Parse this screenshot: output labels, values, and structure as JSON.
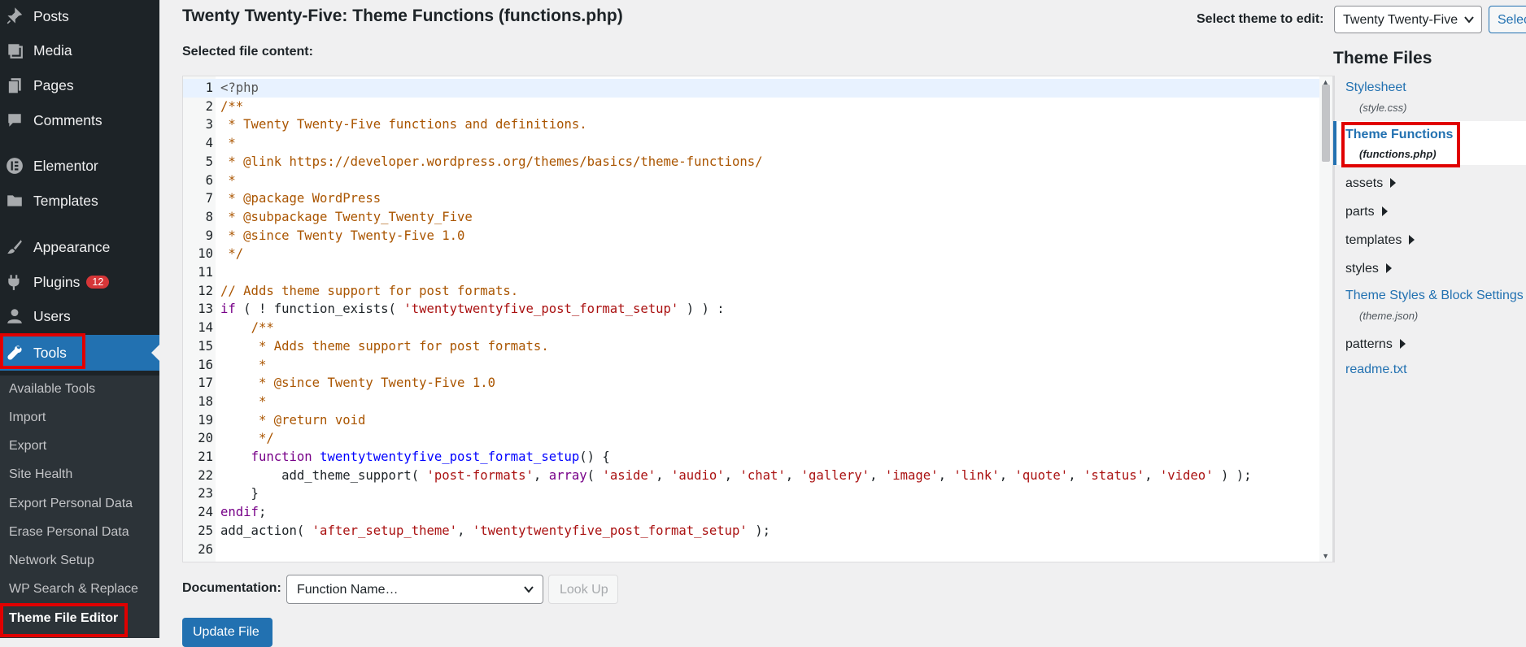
{
  "sidebar": {
    "menu": [
      {
        "label": "Posts",
        "icon": "pin-icon"
      },
      {
        "label": "Media",
        "icon": "media-icon"
      },
      {
        "label": "Pages",
        "icon": "pages-icon"
      },
      {
        "label": "Comments",
        "icon": "comment-icon"
      },
      {
        "label": "Elementor",
        "icon": "elementor-icon"
      },
      {
        "label": "Templates",
        "icon": "folder-icon"
      },
      {
        "label": "Appearance",
        "icon": "brush-icon"
      },
      {
        "label": "Plugins",
        "icon": "plug-icon",
        "badge": "12"
      },
      {
        "label": "Users",
        "icon": "user-icon"
      },
      {
        "label": "Tools",
        "icon": "wrench-icon"
      }
    ],
    "submenu": [
      "Available Tools",
      "Import",
      "Export",
      "Site Health",
      "Export Personal Data",
      "Erase Personal Data",
      "Network Setup",
      "WP Search & Replace",
      "Theme File Editor"
    ]
  },
  "header": {
    "title": "Twenty Twenty-Five: Theme Functions (functions.php)",
    "select_theme_label": "Select theme to edit:",
    "select_theme_value": "Twenty Twenty-Five",
    "select_button": "Select"
  },
  "editor": {
    "label": "Selected file content:",
    "lines": [
      [
        [
          "meta",
          "<?php"
        ]
      ],
      [
        [
          "comment",
          "/**"
        ]
      ],
      [
        [
          "comment",
          " * Twenty Twenty-Five functions and definitions."
        ]
      ],
      [
        [
          "comment",
          " *"
        ]
      ],
      [
        [
          "comment",
          " * @link https://developer.wordpress.org/themes/basics/theme-functions/"
        ]
      ],
      [
        [
          "comment",
          " *"
        ]
      ],
      [
        [
          "comment",
          " * @package WordPress"
        ]
      ],
      [
        [
          "comment",
          " * @subpackage Twenty_Twenty_Five"
        ]
      ],
      [
        [
          "comment",
          " * @since Twenty Twenty-Five 1.0"
        ]
      ],
      [
        [
          "comment",
          " */"
        ]
      ],
      [],
      [
        [
          "comment",
          "// Adds theme support for post formats."
        ]
      ],
      [
        [
          "keyword",
          "if"
        ],
        [
          "plain",
          " ( ! function_exists( "
        ],
        [
          "string",
          "'twentytwentyfive_post_format_setup'"
        ],
        [
          "plain",
          " ) ) :"
        ]
      ],
      [
        [
          "plain",
          "    "
        ],
        [
          "comment",
          "/**"
        ]
      ],
      [
        [
          "plain",
          "    "
        ],
        [
          "comment",
          " * Adds theme support for post formats."
        ]
      ],
      [
        [
          "plain",
          "    "
        ],
        [
          "comment",
          " *"
        ]
      ],
      [
        [
          "plain",
          "    "
        ],
        [
          "comment",
          " * @since Twenty Twenty-Five 1.0"
        ]
      ],
      [
        [
          "plain",
          "    "
        ],
        [
          "comment",
          " *"
        ]
      ],
      [
        [
          "plain",
          "    "
        ],
        [
          "comment",
          " * @return void"
        ]
      ],
      [
        [
          "plain",
          "    "
        ],
        [
          "comment",
          " */"
        ]
      ],
      [
        [
          "plain",
          "    "
        ],
        [
          "keyword",
          "function"
        ],
        [
          "plain",
          " "
        ],
        [
          "def",
          "twentytwentyfive_post_format_setup"
        ],
        [
          "plain",
          "() {"
        ]
      ],
      [
        [
          "plain",
          "        add_theme_support( "
        ],
        [
          "string",
          "'post-formats'"
        ],
        [
          "plain",
          ", "
        ],
        [
          "keyword",
          "array"
        ],
        [
          "plain",
          "( "
        ],
        [
          "string",
          "'aside'"
        ],
        [
          "plain",
          ", "
        ],
        [
          "string",
          "'audio'"
        ],
        [
          "plain",
          ", "
        ],
        [
          "string",
          "'chat'"
        ],
        [
          "plain",
          ", "
        ],
        [
          "string",
          "'gallery'"
        ],
        [
          "plain",
          ", "
        ],
        [
          "string",
          "'image'"
        ],
        [
          "plain",
          ", "
        ],
        [
          "string",
          "'link'"
        ],
        [
          "plain",
          ", "
        ],
        [
          "string",
          "'quote'"
        ],
        [
          "plain",
          ", "
        ],
        [
          "string",
          "'status'"
        ],
        [
          "plain",
          ", "
        ],
        [
          "string",
          "'video'"
        ],
        [
          "plain",
          " ) );"
        ]
      ],
      [
        [
          "plain",
          "    }"
        ]
      ],
      [
        [
          "keyword",
          "endif"
        ],
        [
          "plain",
          ";"
        ]
      ],
      [
        [
          "plain",
          "add_action( "
        ],
        [
          "string",
          "'after_setup_theme'"
        ],
        [
          "plain",
          ", "
        ],
        [
          "string",
          "'twentytwentyfive_post_format_setup'"
        ],
        [
          "plain",
          " );"
        ]
      ],
      []
    ]
  },
  "theme_files": {
    "title": "Theme Files",
    "stylesheet": {
      "label": "Stylesheet",
      "file": "(style.css)"
    },
    "functions": {
      "label": "Theme Functions",
      "file": "(functions.php)"
    },
    "folders": [
      "assets",
      "parts",
      "templates",
      "styles"
    ],
    "theme_json": {
      "label": "Theme Styles & Block Settings",
      "file": "(theme.json)"
    },
    "patterns": "patterns",
    "readme": "readme.txt"
  },
  "footer": {
    "doc_label": "Documentation:",
    "doc_select": "Function Name…",
    "lookup_button": "Look Up",
    "update_button": "Update File"
  },
  "colors": {
    "sidebar_bg": "#1d2327",
    "accent": "#2271b1",
    "highlight_box": "#e00000",
    "badge": "#d63638"
  }
}
